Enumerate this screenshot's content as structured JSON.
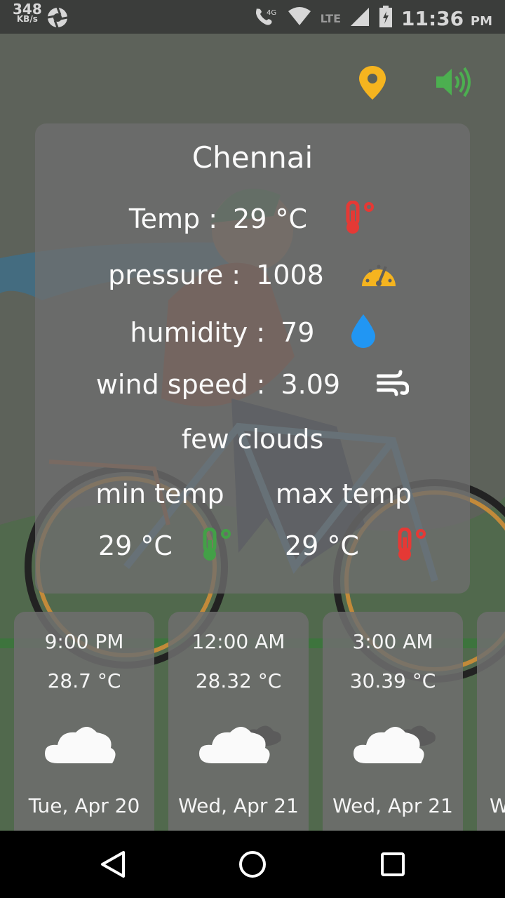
{
  "status_bar": {
    "net_speed": "348",
    "net_speed_unit": "KB/s",
    "network_label": "4G",
    "lte_label": "LTE",
    "time": "11:36",
    "ampm": "PM"
  },
  "toolbar": {
    "location_icon": "location-pin-icon",
    "sound_icon": "speaker-volume-icon"
  },
  "weather": {
    "city": "Chennai",
    "temp_label": "Temp :",
    "temp_value": "29 °C",
    "pressure_label": "pressure :",
    "pressure_value": "1008",
    "humidity_label": "humidity :",
    "humidity_value": "79",
    "wind_label": "wind speed :",
    "wind_value": "3.09",
    "description": "few clouds",
    "min_label": "min temp",
    "min_value": "29 °C",
    "max_label": "max temp",
    "max_value": "29 °C"
  },
  "forecast": [
    {
      "time": "9:00 PM",
      "temp": "28.7 °C",
      "date": "Tue, Apr 20",
      "icon": "cloud-icon"
    },
    {
      "time": "12:00 AM",
      "temp": "28.32 °C",
      "date": "Wed, Apr 21",
      "icon": "cloudy-icon"
    },
    {
      "time": "3:00 AM",
      "temp": "30.39 °C",
      "date": "Wed, Apr 21",
      "icon": "cloudy-icon"
    },
    {
      "time": "",
      "temp": "",
      "date": "W",
      "icon": ""
    }
  ],
  "colors": {
    "location": "#f5b41f",
    "sound": "#4caf50",
    "thermo_hot": "#e53935",
    "thermo_cold": "#43a047",
    "gauge": "#f5b41f",
    "drop": "#2196f3"
  }
}
